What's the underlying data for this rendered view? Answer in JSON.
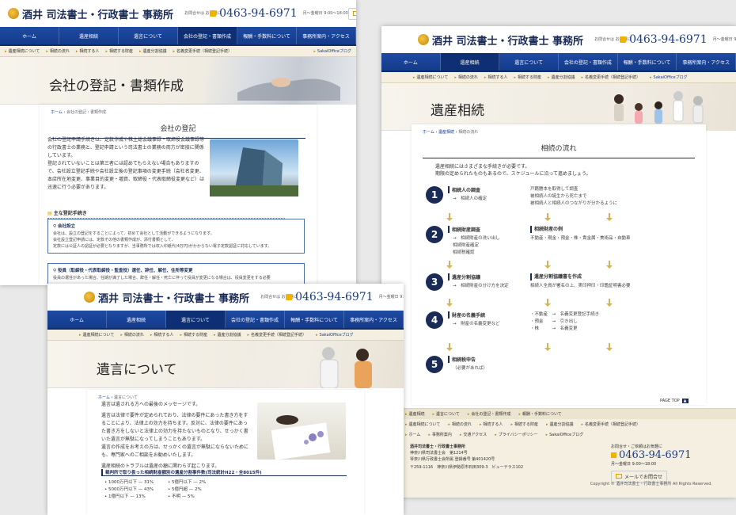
{
  "site": {
    "logo": "酒井 司法書士・行政書士 事務所",
    "tel_label": "お問合せは お気軽に",
    "tel": "0463-94-6971",
    "hours": "月〜金曜日 9:00〜18:00",
    "mail": "メールでお問合せ"
  },
  "nav": [
    "ホーム",
    "遺産相続",
    "遺言について",
    "会社の登記・書類作成",
    "報酬・手数料について",
    "事務所案内・アクセス"
  ],
  "subnav": [
    "遺産相続について",
    "相続の流れ",
    "相続する人",
    "相続する財産",
    "遺産分割協議",
    "名義変更手続（相続登記手続）"
  ],
  "blog": "SakaiOfficeブログ",
  "page1": {
    "hero": "会社の登記・書類作成",
    "crumb_home": "ホーム",
    "crumb_cur": "会社の登記・書類作成",
    "section": "会社の登記",
    "p1": "会社の登記申請手続きは、定款作成や株主総会議事録・取締役会議事録等の行政書士の業務と、登記申請という司法書士の業務の両方が密接に関係しています。",
    "p2": "登記されていないことは第三者には認めてもらえない場合もありますので、会社設立登記手続や会社設立後の登記事項の変更手続（会社名変更、本店所在地変更、事業目的変更・増資、取締役・代表取締役変更など）は迅速に行う必要があります。",
    "list_title": "主な登記手続き",
    "box1_t": "会社設立",
    "box1_d1": "会社は、設立の登記をすることによって、初めて会社として活動ができるようになります。",
    "box1_d2": "会社設立登記申請には、定款その他の書類作成が、添付書類として、",
    "box1_d3": "定款には公証人の認証が必要となりますが、当事務所では収入印紙代(4万円)がかからない電子定款認証に対応しています。",
    "box2_t": "役員（取締役・代表取締役・監査役）選任、辞任、解任、住所等変更",
    "box2_d1": "役員の選任があった場合、任期が満了した場合、辞任・解任・死亡に伴って役員が変更になる場合は、役員変更をする必要"
  },
  "page2": {
    "hero": "遺産相続",
    "crumb_home": "ホーム",
    "crumb_mid": "遺産相続",
    "crumb_cur": "相続の流れ",
    "section": "相続の流れ",
    "intro1": "遺産相続にはさまざまな手続きが必要です。",
    "intro2": "期限の定められたものもあるので、スケジュールに沿って進めましょう。",
    "steps": [
      {
        "n": "1",
        "t": "相続人の調査",
        "l": [
          "→　相続人の確定"
        ],
        "rt": "",
        "r": [
          "戸籍謄本を取得して調査",
          "被相続人の誕生から死亡まで",
          "被相続人と相続人のつながりが分かるように"
        ]
      },
      {
        "n": "2",
        "t": "相続財産調査",
        "l": [
          "→　相続財産の洗い出し",
          "相続財産確定",
          "相続税確認"
        ],
        "rt": "相続財産の例",
        "r": [
          "不動産・現金・預金・株・貴金属・美術品・自動車"
        ]
      },
      {
        "n": "3",
        "t": "遺産分割協議",
        "l": [
          "→　相続財産の分け方を決定"
        ],
        "rt": "遺産分割協議書を作成",
        "r": [
          "相続人全員が署名の上、実印押印・印鑑証明書必要"
        ]
      },
      {
        "n": "4",
        "t": "財産の名義手続",
        "l": [
          "→　財産の名義変更など"
        ],
        "rt": "",
        "r": [
          "・不動産　→　名義変更登記手続き",
          "・預金　　→　引き出し",
          "・株　　　→　名義変更"
        ]
      },
      {
        "n": "5",
        "t": "相続税申告",
        "l": [
          "（必要があれば）"
        ],
        "rt": "",
        "r": []
      }
    ],
    "pagetop": "PAGE TOP",
    "footer_links1": [
      "遺産相続",
      "遺言について",
      "会社の登記・書類作成",
      "報酬・手数料について"
    ],
    "footer_links2": [
      "遺産相続について",
      "相続の流れ",
      "相続する人",
      "相続する財産",
      "遺産分割協議",
      "名義変更手続（相続登記手続）"
    ],
    "footer_links3": [
      "ホーム",
      "事務所案内",
      "交通アクセス",
      "プライバシーポリシー",
      "SakaiOfficeブログ"
    ],
    "office_name": "酒井司法書士・行政書士事務所",
    "office_l1": "神奈川県司法書士会　第1214号",
    "office_l2": "琴奈川県行政書士会所属 登録番号 第401420号",
    "office_l3": "〒259-1116　神奈川県伊勢原市石田309-3　ビューテラス102",
    "contact_label": "お問合せ・ご依頼はお気軽に",
    "copyright": "Copyright © 酒井司法書士・行政書士事務所 All Rights Reserved."
  },
  "page3": {
    "hero": "遺言について",
    "crumb_home": "ホーム",
    "crumb_cur": "遺言について",
    "p1": "遺言は遺される方への最後のメッセージです。",
    "p2": "遺言は法律で要件が定められており、法律の要件にあった書き方をすることにより、法律上の効力を持ちます。反対に、法律の要件にあった書き方をしないと法律上の効力を持たないものとなり、せっかく書いた遺言が無駄になってしまうこともあります。",
    "p3": "遺言の作成をお考えの方は、せっかくの遺言が無駄にならないためにも、専門家へのご相談をお勧めいたします。",
    "p4": "遺産相続のトラブルは遺産の額に関わらず起こります。",
    "stat_title": "裁判所で取り扱った相続財産額別の遺産分割事件数(司法統計H22・全8015件)",
    "stats": [
      [
        "1000万円以下",
        "31%"
      ],
      [
        "5億円以下",
        "2%"
      ],
      [
        "5000万円以下",
        "43%"
      ],
      [
        "5億円超",
        "2%"
      ],
      [
        "1億円以下",
        "13%"
      ],
      [
        "不明",
        "5%"
      ]
    ]
  }
}
